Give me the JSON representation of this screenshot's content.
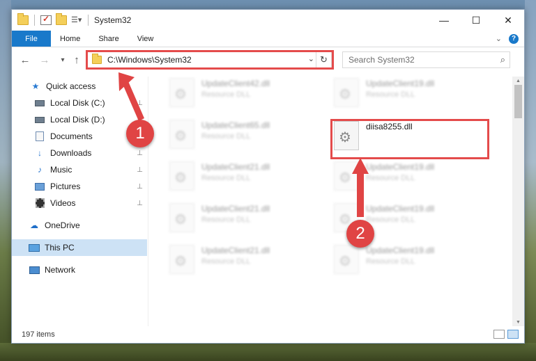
{
  "window": {
    "title": "System32",
    "controls": {
      "minimize": "—",
      "maximize": "☐",
      "close": "✕"
    }
  },
  "ribbon": {
    "file": "File",
    "tabs": [
      "Home",
      "Share",
      "View"
    ]
  },
  "nav": {
    "back": "←",
    "forward": "→",
    "recent": "▾",
    "up": "↑"
  },
  "address": {
    "path": "C:\\Windows\\System32",
    "dropdown": "⌄",
    "refresh": "↻"
  },
  "search": {
    "placeholder": "Search System32",
    "icon": "⌕"
  },
  "sidebar": {
    "items": [
      {
        "label": "Quick access",
        "icon": "star-icon"
      },
      {
        "label": "Local Disk (C:)",
        "icon": "drive-icon",
        "pin": "📌"
      },
      {
        "label": "Local Disk (D:)",
        "icon": "drive-icon",
        "pin": "📌"
      },
      {
        "label": "Documents",
        "icon": "document-icon",
        "pin": "📌"
      },
      {
        "label": "Downloads",
        "icon": "download-icon",
        "pin": "📌"
      },
      {
        "label": "Music",
        "icon": "music-icon",
        "pin": "📌"
      },
      {
        "label": "Pictures",
        "icon": "pictures-icon",
        "pin": "📌"
      },
      {
        "label": "Videos",
        "icon": "video-icon",
        "pin": "📌"
      },
      {
        "label": "OneDrive",
        "icon": "cloud-icon"
      },
      {
        "label": "This PC",
        "icon": "computer-icon"
      },
      {
        "label": "Network",
        "icon": "network-icon"
      }
    ]
  },
  "files": [
    {
      "name": "UpdateClient42.dll",
      "type": "Resource DLL"
    },
    {
      "name": "UpdateClient19.dll",
      "type": "Resource DLL"
    },
    {
      "name": "UpdateClient65.dll",
      "type": "Resource DLL"
    },
    {
      "name": "diisa8255.dll",
      "type": ""
    },
    {
      "name": "UpdateClient21.dll",
      "type": "Resource DLL"
    },
    {
      "name": "UpdateClient19.dll",
      "type": "Resource DLL"
    },
    {
      "name": "UpdateClient21.dll",
      "type": "Resource DLL"
    },
    {
      "name": "UpdateClient19.dll",
      "type": "Resource DLL"
    },
    {
      "name": "UpdateClient21.dll",
      "type": "Resource DLL"
    },
    {
      "name": "UpdateClient19.dll",
      "type": "Resource DLL"
    }
  ],
  "status": {
    "count": "197 items"
  },
  "annotations": {
    "step1": "1",
    "step2": "2",
    "color": "#e04444"
  }
}
